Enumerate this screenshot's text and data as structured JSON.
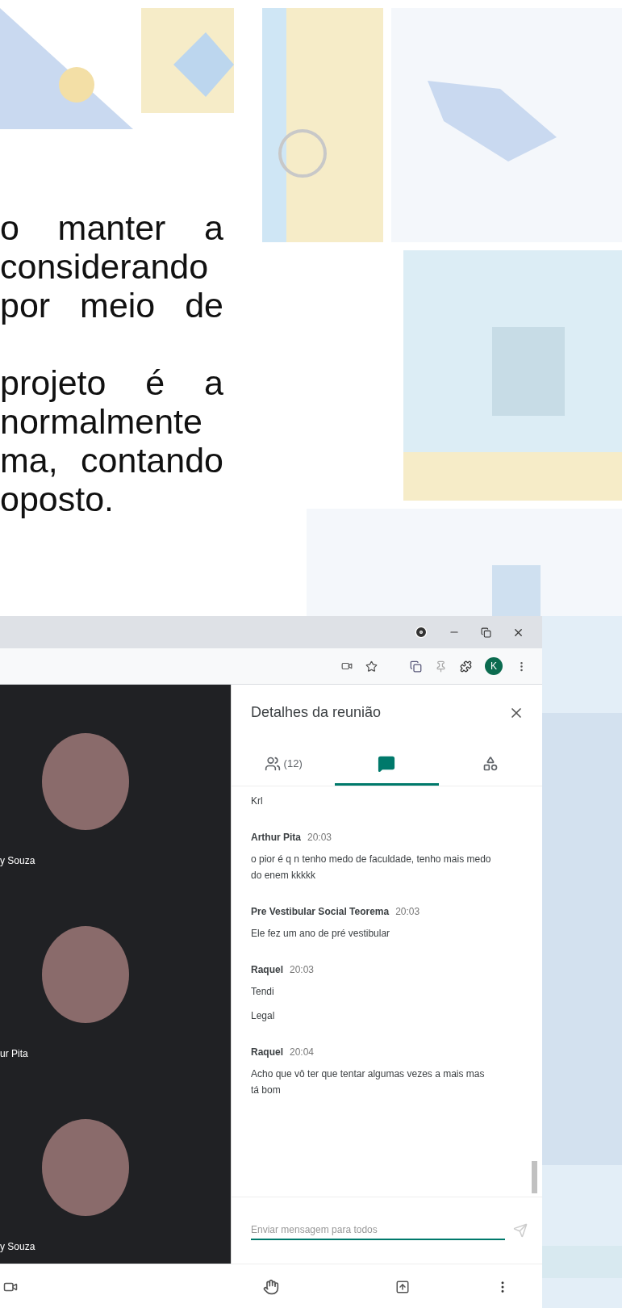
{
  "document": {
    "paragraphs": [
      {
        "lines": [
          "o manter a",
          "considerando",
          "por meio de"
        ]
      },
      {
        "lines": [
          "projeto é a",
          "normalmente",
          "ma, contando",
          "oposto."
        ]
      }
    ]
  },
  "browser": {
    "profile_initial": "K"
  },
  "participants": [
    {
      "name": "y Souza"
    },
    {
      "name": "ur Pita"
    },
    {
      "name": "y Souza"
    }
  ],
  "panel": {
    "title": "Detalhes da reunião",
    "tabs": [
      {
        "kind": "people",
        "label": "(12)",
        "selected": false
      },
      {
        "kind": "chat",
        "selected": true
      },
      {
        "kind": "activities",
        "selected": false
      }
    ],
    "messages": [
      {
        "texts": [
          "Krl"
        ]
      },
      {
        "sender": "Arthur Pita",
        "time": "20:03",
        "texts": [
          "o pior é q n tenho medo de faculdade, tenho mais medo do enem kkkkk"
        ]
      },
      {
        "sender": "Pre Vestibular Social Teorema",
        "time": "20:03",
        "texts": [
          "Ele fez um ano de pré vestibular"
        ]
      },
      {
        "sender": "Raquel",
        "time": "20:03",
        "texts": [
          "Tendi",
          "Legal"
        ]
      },
      {
        "sender": "Raquel",
        "time": "20:04",
        "texts": [
          "Acho que vô ter que tentar algumas vezes a mais mas tá bom"
        ]
      }
    ],
    "input": {
      "placeholder": "Enviar mensagem para todos"
    }
  }
}
